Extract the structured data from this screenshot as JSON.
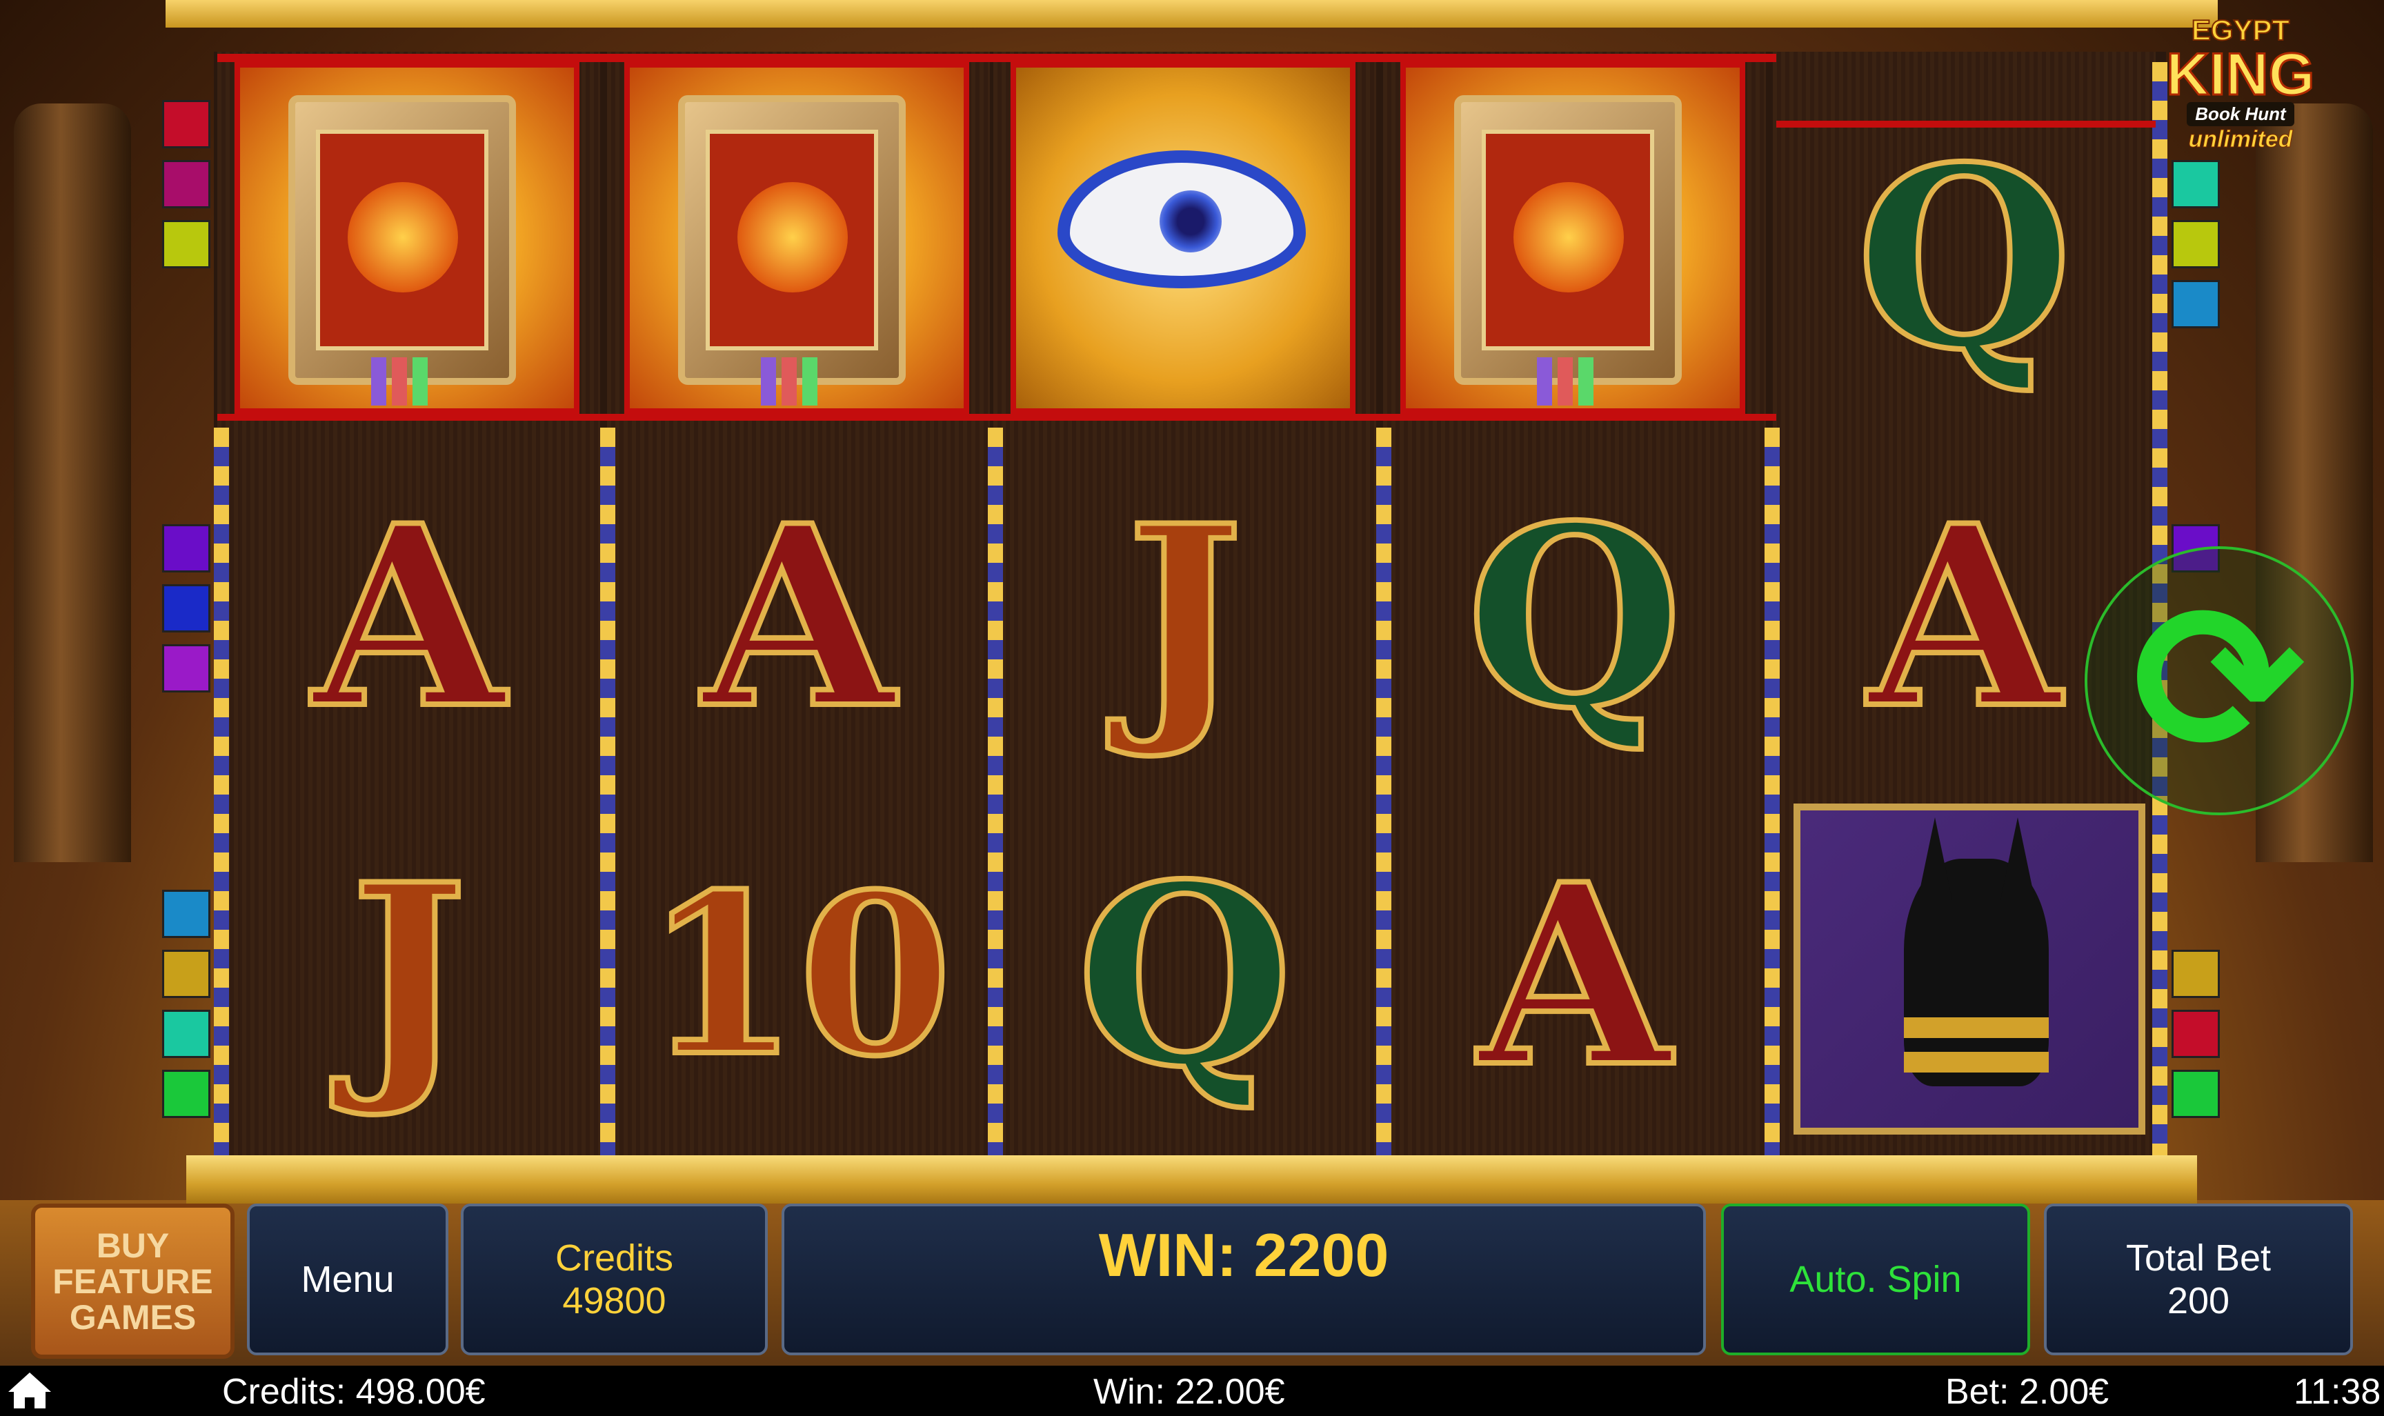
{
  "game": {
    "logo_line1": "EGYPT",
    "logo_line2": "KING",
    "logo_line3": "Book Hunt",
    "logo_line4": "unlimited"
  },
  "reels": [
    [
      "book",
      "A",
      "J"
    ],
    [
      "book",
      "A",
      "10"
    ],
    [
      "eye-of-horus",
      "J",
      "Q"
    ],
    [
      "book",
      "Q",
      "A"
    ],
    [
      "Q",
      "A",
      "anubis"
    ]
  ],
  "spin_icon": "refresh-arrows-icon",
  "controls": {
    "buy_feature_line1": "BUY",
    "buy_feature_line2": "FEATURE",
    "buy_feature_line3": "GAMES",
    "menu_label": "Menu",
    "credits_label": "Credits",
    "credits_value": "49800",
    "win_text": "WIN: 2200",
    "autospin_label": "Auto. Spin",
    "total_bet_label": "Total Bet",
    "total_bet_value": "200"
  },
  "status_bar": {
    "credits": "Credits: 498.00€",
    "win": "Win: 22.00€",
    "bet": "Bet: 2.00€",
    "time": "11:38"
  },
  "colors": {
    "win_line": "#c40d0d",
    "spin_green": "#22d52a",
    "gold_text": "#ffd23a"
  }
}
